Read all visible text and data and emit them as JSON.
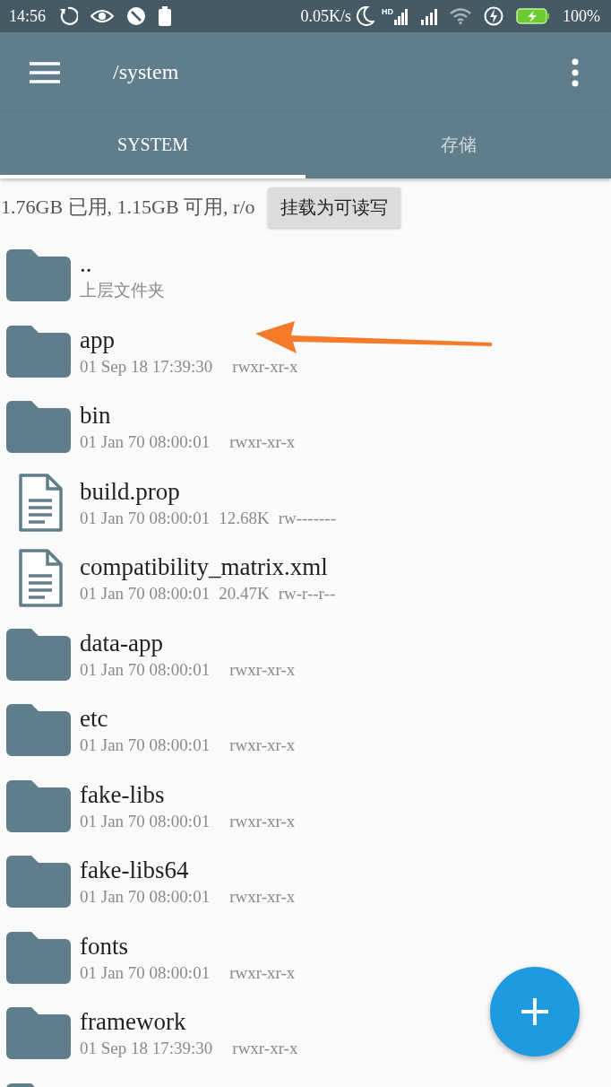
{
  "status_bar": {
    "time": "14:56",
    "speed": "0.05K/s",
    "network_label": "HD",
    "battery": "100%"
  },
  "toolbar": {
    "path": "/system"
  },
  "tabs": [
    {
      "label": "SYSTEM",
      "selected": true
    },
    {
      "label": "存储",
      "selected": false
    }
  ],
  "storage": {
    "summary": "1.76GB 已用, 1.15GB 可用, r/o",
    "button": "挂载为可读写"
  },
  "files": [
    {
      "kind": "folder",
      "name": "..",
      "subtitle": "上层文件夹"
    },
    {
      "kind": "folder",
      "name": "app",
      "date": "01 Sep 18 17:39:30",
      "perms": "rwxr-xr-x"
    },
    {
      "kind": "folder",
      "name": "bin",
      "date": "01 Jan 70 08:00:01",
      "perms": "rwxr-xr-x"
    },
    {
      "kind": "file",
      "name": "build.prop",
      "date": "01 Jan 70 08:00:01",
      "size": "12.68K",
      "perms": "rw-------"
    },
    {
      "kind": "file",
      "name": "compatibility_matrix.xml",
      "date": "01 Jan 70 08:00:01",
      "size": "20.47K",
      "perms": "rw-r--r--"
    },
    {
      "kind": "folder",
      "name": "data-app",
      "date": "01 Jan 70 08:00:01",
      "perms": "rwxr-xr-x"
    },
    {
      "kind": "folder",
      "name": "etc",
      "date": "01 Jan 70 08:00:01",
      "perms": "rwxr-xr-x"
    },
    {
      "kind": "folder",
      "name": "fake-libs",
      "date": "01 Jan 70 08:00:01",
      "perms": "rwxr-xr-x"
    },
    {
      "kind": "folder",
      "name": "fake-libs64",
      "date": "01 Jan 70 08:00:01",
      "perms": "rwxr-xr-x"
    },
    {
      "kind": "folder",
      "name": "fonts",
      "date": "01 Jan 70 08:00:01",
      "perms": "rwxr-xr-x"
    },
    {
      "kind": "folder",
      "name": "framework",
      "date": "01 Sep 18 17:39:30",
      "perms": "rwxr-xr-x"
    },
    {
      "kind": "folder"
    }
  ]
}
